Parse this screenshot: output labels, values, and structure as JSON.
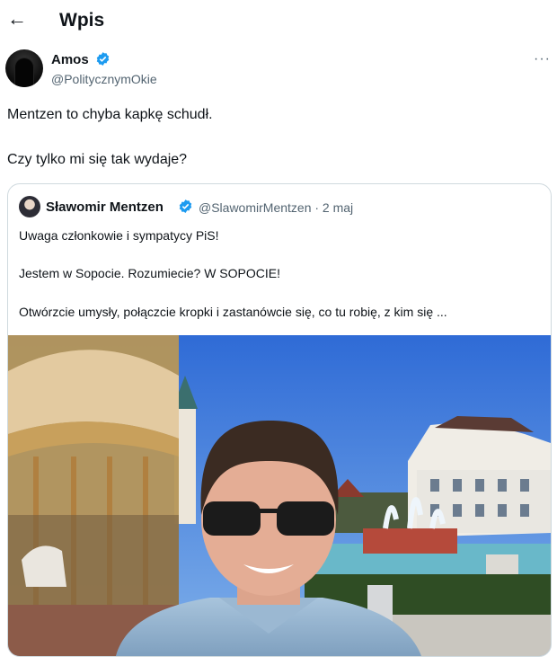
{
  "header": {
    "title": "Wpis",
    "back_icon": "arrow-left-icon"
  },
  "post": {
    "author_name": "Amos",
    "author_handle": "@PolitycznymOkie",
    "more_label": "···",
    "lines": [
      "Mentzen to chyba kapkę schudł.",
      "Czy tylko mi się tak wydaje?"
    ]
  },
  "quoted": {
    "author_name": "Sławomir Mentzen",
    "author_handle": "@SlawomirMentzen",
    "date": "· 2 maj",
    "lines": [
      "Uwaga członkowie i sympatycy PiS!",
      "Jestem w Sopocie. Rozumiecie? W SOPOCIE!",
      "Otwórzcie umysły, połączcie kropki i zastanówcie się, co tu robię, z kim się ..."
    ]
  },
  "colors": {
    "verified_blue": "#1d9bf0",
    "secondary_text": "#536471",
    "border": "#cfd9de"
  }
}
